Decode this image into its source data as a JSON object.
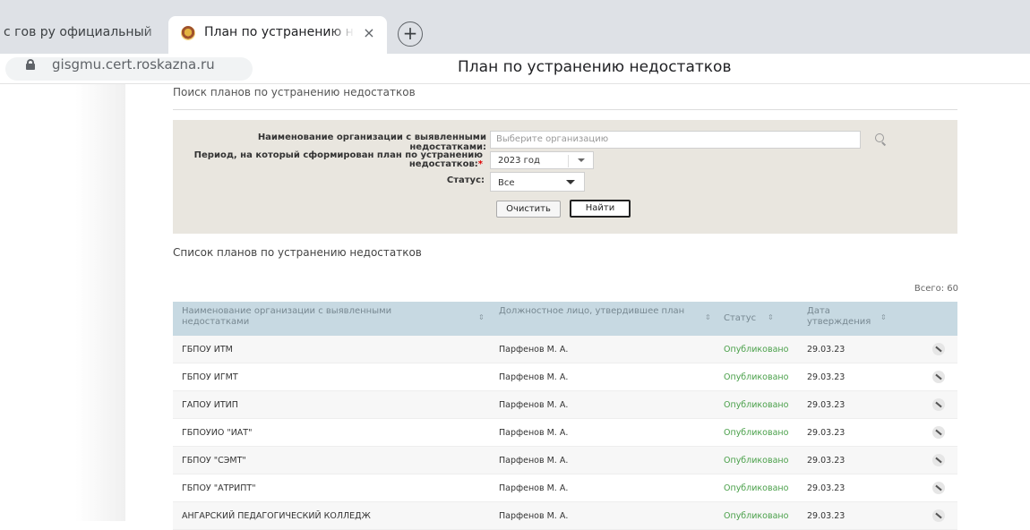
{
  "browser": {
    "inactive_tab_title": "с гов ру официальный",
    "active_tab_title": "План по устранению не",
    "tab_close": "×",
    "new_tab": "+",
    "url": "gisgmu.cert.roskazna.ru",
    "page_title": "План по устранению недостатков"
  },
  "search": {
    "section_title": "Поиск планов по устранению недостатков",
    "org_label": "Наименование организации с выявленными недостатками:",
    "org_placeholder": "Выберите организацию",
    "period_label_line1": "Период, на который сформирован план по устранению",
    "period_label_line2": "недостатков:",
    "required_mark": "*",
    "period_value": "2023 год",
    "status_label": "Статус:",
    "status_value": "Все",
    "clear_button": "Очистить",
    "find_button": "Найти"
  },
  "list": {
    "section_title": "Список планов по устранению недостатков",
    "total": "Всего: 60",
    "columns": {
      "org": "Наименование организации с выявленными недостатками",
      "official": "Должностное лицо, утвердившее план",
      "status": "Статус",
      "date": "Дата утверждения",
      "sort": "⇕"
    },
    "rows": [
      {
        "org": "ГБПОУ ИТМ",
        "official": "Парфенов М. А.",
        "status": "Опубликовано",
        "date": "29.03.23"
      },
      {
        "org": "ГБПОУ ИГМТ",
        "official": "Парфенов М. А.",
        "status": "Опубликовано",
        "date": "29.03.23"
      },
      {
        "org": "ГАПОУ ИТИП",
        "official": "Парфенов М. А.",
        "status": "Опубликовано",
        "date": "29.03.23"
      },
      {
        "org": "ГБПОУИО \"ИАТ\"",
        "official": "Парфенов М. А.",
        "status": "Опубликовано",
        "date": "29.03.23"
      },
      {
        "org": "ГБПОУ \"СЭМТ\"",
        "official": "Парфенов М. А.",
        "status": "Опубликовано",
        "date": "29.03.23"
      },
      {
        "org": "ГБПОУ \"АТРИПТ\"",
        "official": "Парфенов М. А.",
        "status": "Опубликовано",
        "date": "29.03.23"
      },
      {
        "org": "АНГАРСКИЙ ПЕДАГОГИЧЕСКИЙ КОЛЛЕДЖ",
        "official": "Парфенов М. А.",
        "status": "Опубликовано",
        "date": "29.03.23"
      }
    ]
  }
}
